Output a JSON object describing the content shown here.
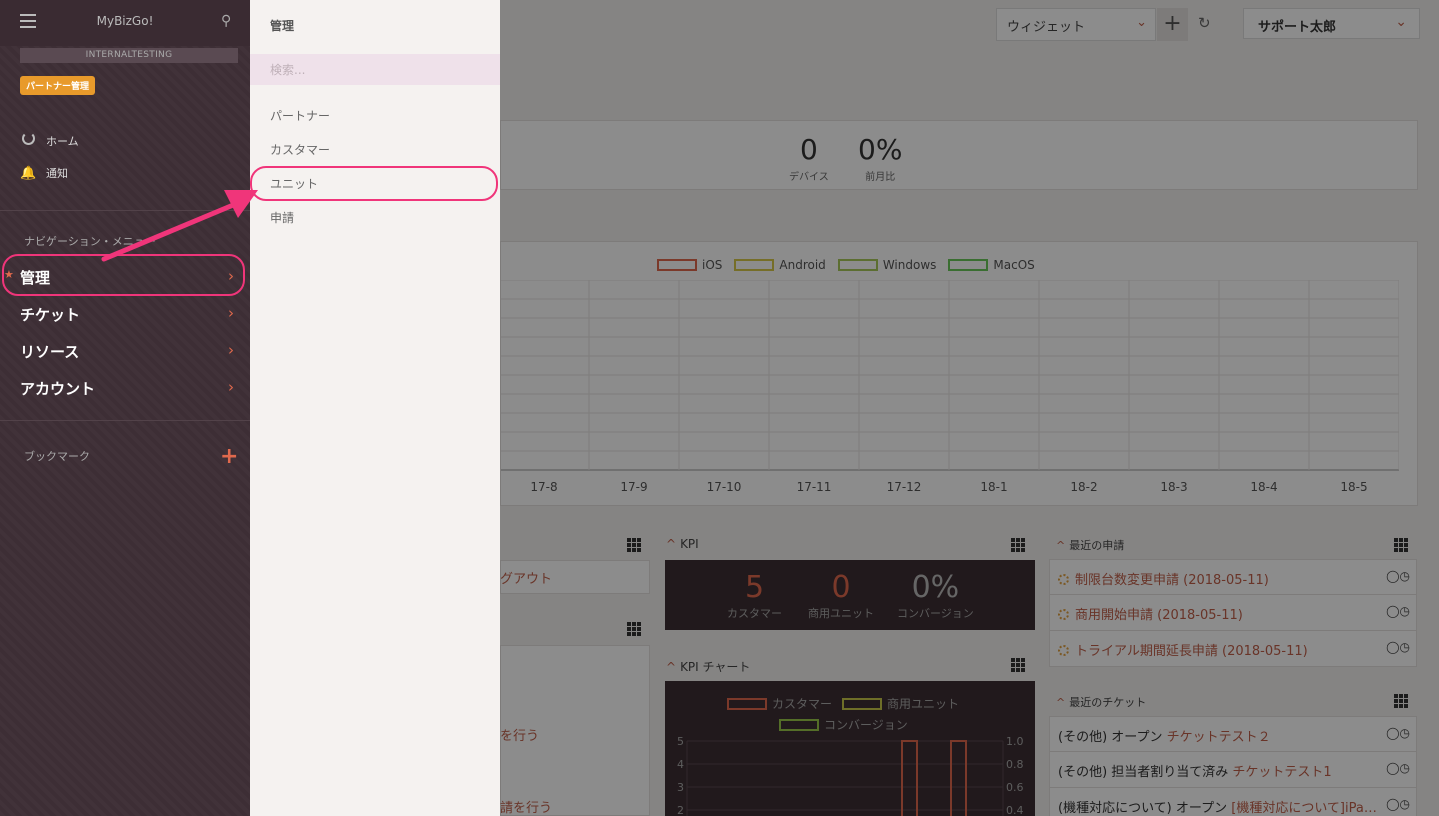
{
  "header": {
    "widget_select": "ウィジェット",
    "add_label": "+",
    "user": "サポート太郎"
  },
  "stats": [
    {
      "value": "0",
      "label": "デバイス"
    },
    {
      "value": "0%",
      "label": "前月比"
    }
  ],
  "chart_data": {
    "type": "line",
    "categories": [
      "17-8",
      "17-9",
      "17-10",
      "17-11",
      "17-12",
      "18-1",
      "18-2",
      "18-3",
      "18-4",
      "18-5"
    ],
    "series": [
      {
        "name": "iOS",
        "values": [
          0,
          0,
          0,
          0,
          0,
          0,
          0,
          0,
          0,
          0
        ]
      },
      {
        "name": "Android",
        "values": [
          0,
          0,
          0,
          0,
          0,
          0,
          0,
          0,
          0,
          0
        ]
      },
      {
        "name": "Windows",
        "values": [
          0,
          0,
          0,
          0,
          0,
          0,
          0,
          0,
          0,
          0
        ]
      },
      {
        "name": "MacOS",
        "values": [
          0,
          0,
          0,
          0,
          0,
          0,
          0,
          0,
          0,
          0
        ]
      }
    ],
    "legend_colors": [
      "#e0694d",
      "#d8c84a",
      "#a8c85a",
      "#6ac85a"
    ],
    "grid": true,
    "legend": "top-center"
  },
  "kpi": {
    "title": "KPI",
    "items": [
      {
        "value": "5",
        "label": "カスタマー"
      },
      {
        "value": "0",
        "label": "商用ユニット"
      },
      {
        "value": "0%",
        "label": "コンバージョン"
      }
    ]
  },
  "kpi_chart": {
    "title": "KPI チャート",
    "legend": [
      "カスタマー",
      "商用ユニット",
      "コンバージョン"
    ],
    "left_ticks": [
      "5",
      "4",
      "3",
      "2"
    ],
    "right_ticks": [
      "1.0",
      "0.8",
      "0.6",
      "0.4"
    ]
  },
  "recent_requests": {
    "title": "最近の申請",
    "items": [
      {
        "text": "制限台数変更申請 (2018-05-11)"
      },
      {
        "text": "商用開始申請 (2018-05-11)"
      },
      {
        "text": "トライアル期間延長申請 (2018-05-11)"
      }
    ]
  },
  "recent_tickets": {
    "title": "最近のチケット",
    "items": [
      {
        "prefix": "(その他) オープン",
        "link": "チケットテスト２"
      },
      {
        "prefix": "(その他) 担当者割り当て済み",
        "link": "チケットテスト1"
      },
      {
        "prefix": "(機種対応について) オープン",
        "link": "[機種対応について]iPa…"
      }
    ]
  },
  "left_partials": [
    "グアウト",
    "を行う",
    "請を行う"
  ],
  "sidebar": {
    "brand": "MyBizGo!",
    "tenant": "INTERNALTESTING",
    "badge": "パートナー管理",
    "home": "ホーム",
    "notify": "通知",
    "nav_section": "ナビゲーション・メニュー",
    "nav": [
      {
        "label": "管理"
      },
      {
        "label": "チケット"
      },
      {
        "label": "リソース"
      },
      {
        "label": "アカウント"
      }
    ],
    "bookmark": "ブックマーク"
  },
  "submenu": {
    "title": "管理",
    "search_placeholder": "検索...",
    "items": [
      "パートナー",
      "カスタマー",
      "ユニット",
      "申請"
    ]
  }
}
